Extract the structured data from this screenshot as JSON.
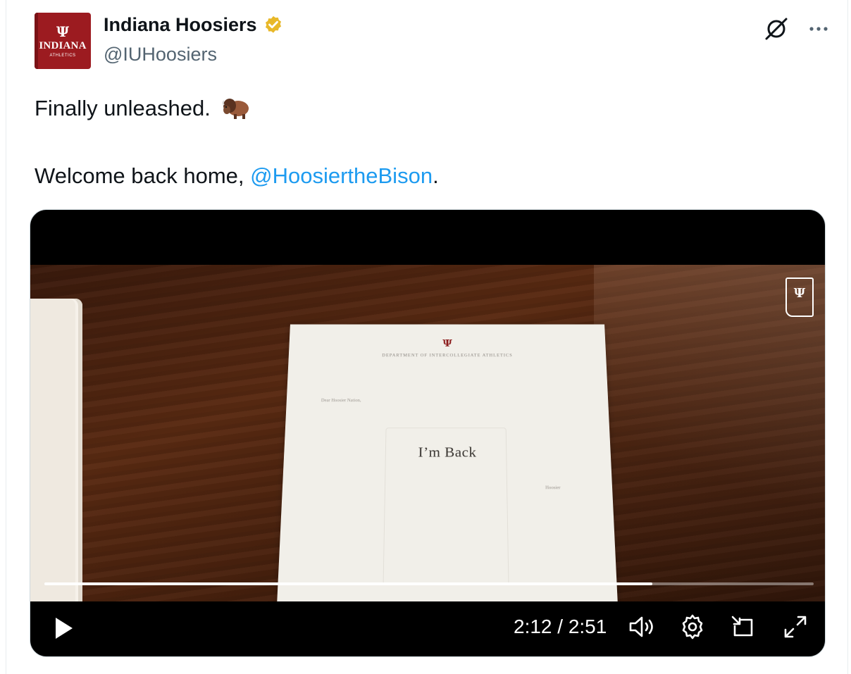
{
  "author": {
    "display_name": "Indiana Hoosiers",
    "handle": "@IUHoosiers",
    "avatar": {
      "emblem": "Ψ",
      "brand": "INDIANA",
      "sub": "ATHLETICS"
    },
    "verified_badge_color": "#e8b829"
  },
  "tweet": {
    "line1": "Finally unleashed.",
    "line1_emoji": "bison-emoji",
    "line2_prefix": "Welcome back home, ",
    "line2_mention": "@HoosiertheBison",
    "line2_suffix": "."
  },
  "video": {
    "frame": {
      "letterhead_emblem": "Ψ",
      "letterhead_dept": "DEPARTMENT OF INTERCOLLEGIATE ATHLETICS",
      "salutation": "Dear Hoosier Nation,",
      "headline": "I’m Back",
      "signature": "Hoosier",
      "corner_badge": "Ψ"
    },
    "progress_fraction": 0.79,
    "time_display": "2:12 / 2:51"
  },
  "icons": {
    "grok": "grok-icon",
    "more": "more-icon",
    "play": "play-icon",
    "volume": "volume-icon",
    "settings": "gear-icon",
    "popout": "popout-icon",
    "fullscreen": "fullscreen-icon"
  },
  "colors": {
    "link": "#1d9bf0",
    "secondary_text": "#536471",
    "brand_crimson": "#9c1b20"
  }
}
